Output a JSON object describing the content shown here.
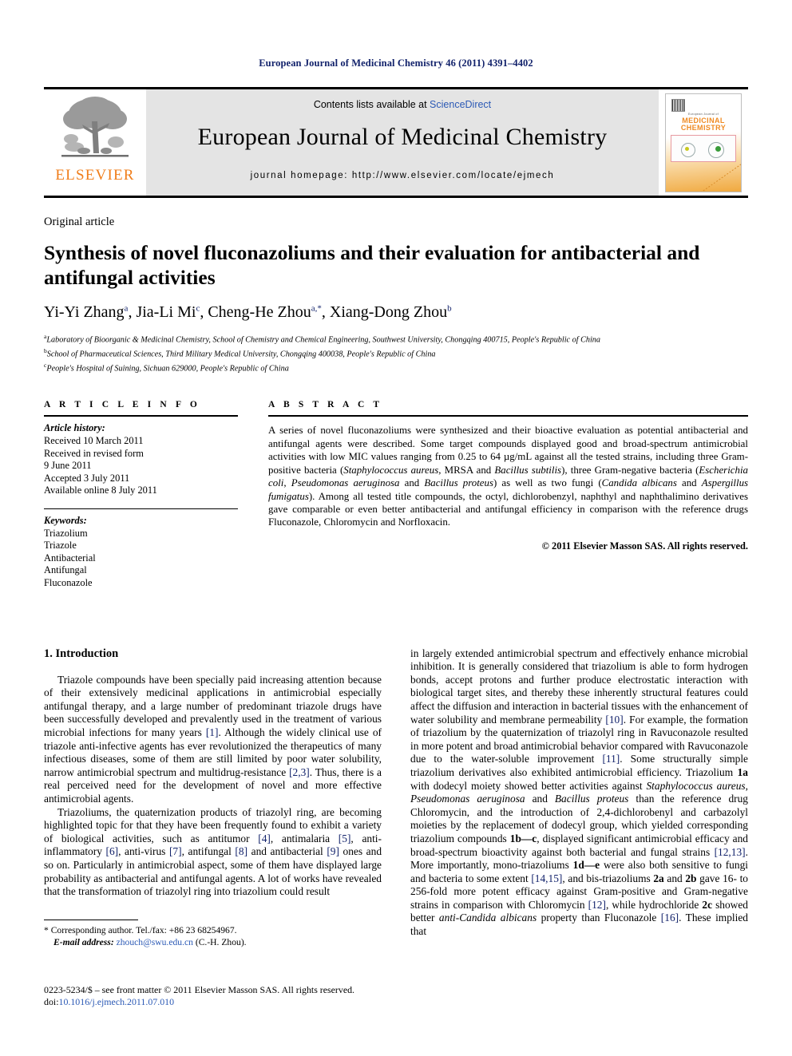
{
  "running_head": "European Journal of Medicinal Chemistry 46 (2011) 4391–4402",
  "masthead": {
    "publisher_logo_text": "ELSEVIER",
    "contents_prefix": "Contents lists available at ",
    "contents_link": "ScienceDirect",
    "journal_title": "European Journal of Medicinal Chemistry",
    "homepage_line": "journal homepage: http://www.elsevier.com/locate/ejmech",
    "cover": {
      "line1": "European Journal of",
      "line2": "MEDICINAL",
      "line3": "CHEMISTRY",
      "accent_color": "#ef8a22"
    }
  },
  "article": {
    "type": "Original article",
    "title": "Synthesis of novel fluconazoliums and their evaluation for antibacterial and antifungal activities",
    "authors": [
      {
        "name": "Yi-Yi Zhang",
        "sup": "a"
      },
      {
        "name": "Jia-Li Mi",
        "sup": "c"
      },
      {
        "name": "Cheng-He Zhou",
        "sup": "a,*"
      },
      {
        "name": "Xiang-Dong Zhou",
        "sup": "b"
      }
    ],
    "affiliations": [
      {
        "marker": "a",
        "text": "Laboratory of Bioorganic & Medicinal Chemistry, School of Chemistry and Chemical Engineering, Southwest University, Chongqing 400715, People's Republic of China"
      },
      {
        "marker": "b",
        "text": "School of Pharmaceutical Sciences, Third Military Medical University, Chongqing 400038, People's Republic of China"
      },
      {
        "marker": "c",
        "text": "People's Hospital of Suining, Sichuan 629000, People's Republic of China"
      }
    ]
  },
  "article_info": {
    "heading": "A R T I C L E   I N F O",
    "history_label": "Article history:",
    "history": [
      "Received 10 March 2011",
      "Received in revised form",
      "9 June 2011",
      "Accepted 3 July 2011",
      "Available online 8 July 2011"
    ],
    "keywords_label": "Keywords:",
    "keywords": [
      "Triazolium",
      "Triazole",
      "Antibacterial",
      "Antifungal",
      "Fluconazole"
    ]
  },
  "abstract": {
    "heading": "A B S T R A C T",
    "copyright": "© 2011 Elsevier Masson SAS. All rights reserved."
  },
  "introduction": {
    "heading": "1.  Introduction"
  },
  "footnote": {
    "corresponding": "* Corresponding author. Tel./fax: +86 23 68254967.",
    "email_label": "E-mail address:",
    "email": "zhouch@swu.edu.cn",
    "email_suffix": "(C.-H. Zhou)."
  },
  "footer": {
    "issn_line": "0223-5234/$ – see front matter © 2011 Elsevier Masson SAS. All rights reserved.",
    "doi_label": "doi:",
    "doi": "10.1016/j.ejmech.2011.07.010"
  }
}
